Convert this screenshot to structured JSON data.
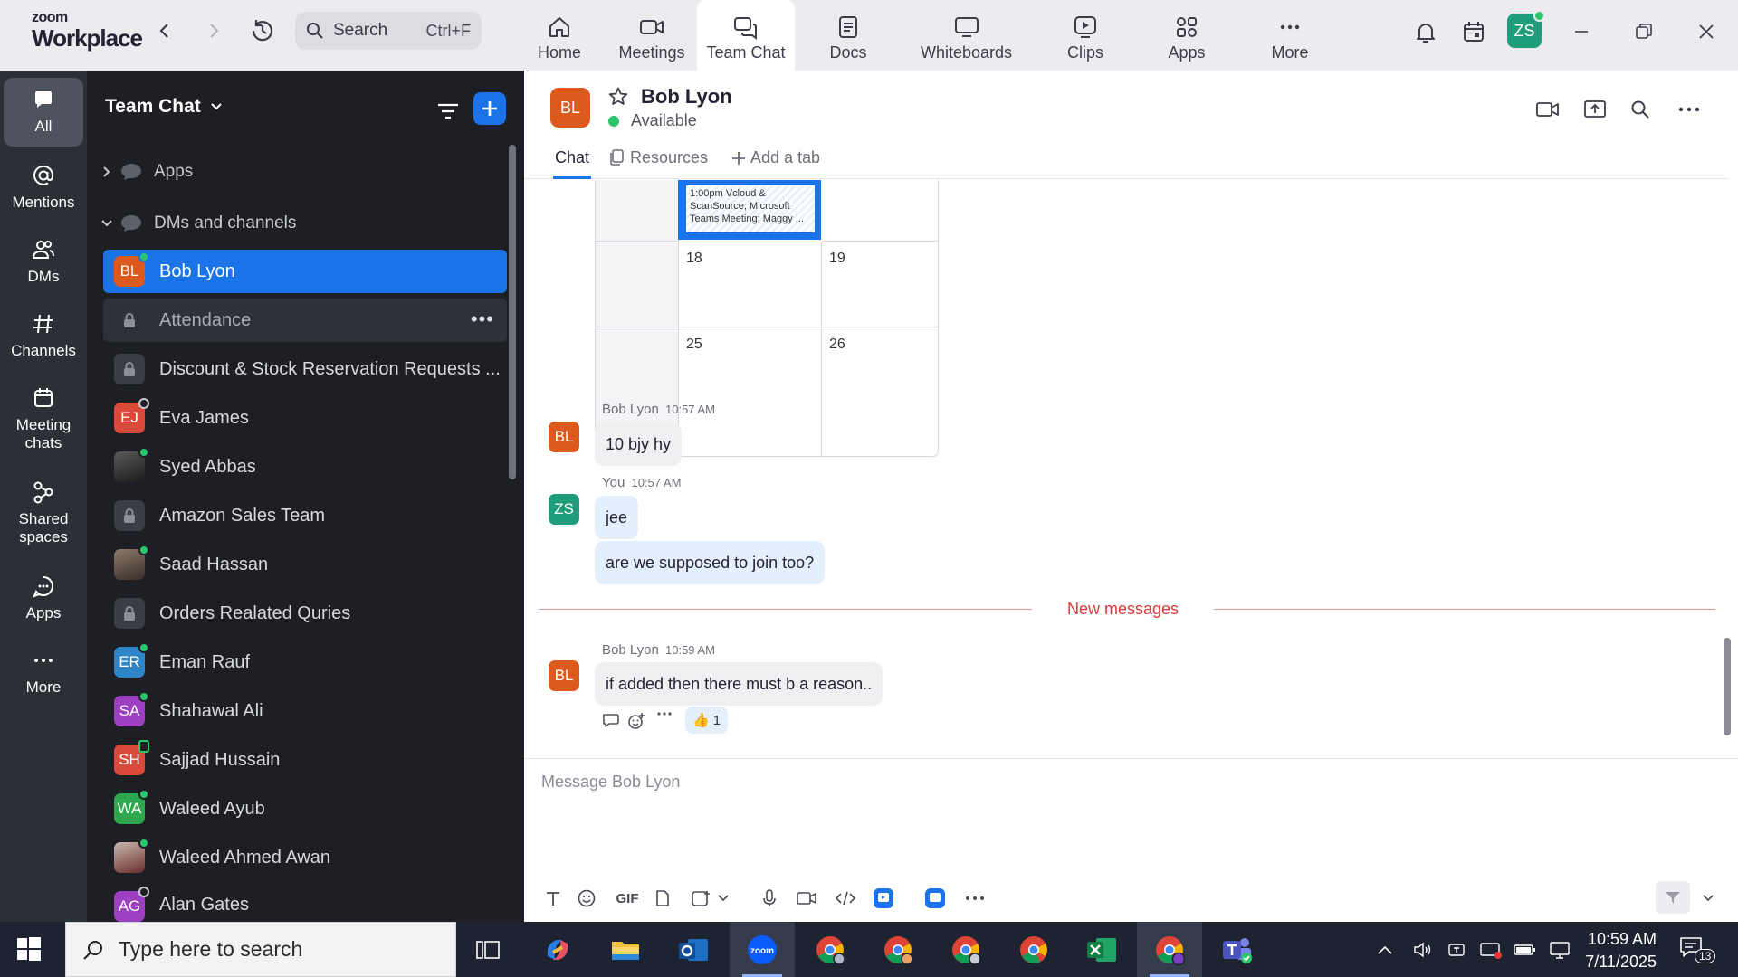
{
  "brand": {
    "line1": "zoom",
    "line2": "Workplace"
  },
  "search": {
    "label": "Search",
    "shortcut": "Ctrl+F"
  },
  "top_tabs": [
    {
      "label": "Home",
      "icon": "home-icon"
    },
    {
      "label": "Meetings",
      "icon": "video-camera-icon"
    },
    {
      "label": "Team Chat",
      "icon": "chat-bubbles-icon",
      "active": true
    },
    {
      "label": "Docs",
      "icon": "document-icon"
    },
    {
      "label": "Whiteboards",
      "icon": "whiteboard-icon"
    },
    {
      "label": "Clips",
      "icon": "clips-icon"
    },
    {
      "label": "Apps",
      "icon": "apps-grid-icon"
    },
    {
      "label": "More",
      "icon": "more-dots-icon"
    }
  ],
  "user": {
    "initials": "ZS"
  },
  "rail": [
    {
      "label": "All",
      "icon": "chat-icon",
      "active": true
    },
    {
      "label": "Mentions",
      "icon": "at-icon"
    },
    {
      "label": "DMs",
      "icon": "people-icon"
    },
    {
      "label": "Channels",
      "icon": "hash-icon"
    },
    {
      "label": "Meeting\nchats",
      "label1": "Meeting",
      "label2": "chats",
      "icon": "calendar-icon"
    },
    {
      "label1": "Shared",
      "label2": "spaces",
      "icon": "shared-spaces-icon"
    },
    {
      "label": "Apps",
      "icon": "apps-bubble-icon"
    },
    {
      "label": "More",
      "icon": "more-dots-icon"
    }
  ],
  "channel_list": {
    "title": "Team Chat",
    "sections": {
      "apps": "Apps",
      "dms": "DMs and channels"
    },
    "rows": [
      {
        "name": "Bob Lyon",
        "initials": "BL",
        "color": "#dd5a1f",
        "status": "online",
        "selected": true
      },
      {
        "name": "Attendance",
        "type": "private-channel",
        "hover": true
      },
      {
        "name": "Discount & Stock Reservation Requests ...",
        "type": "private-channel"
      },
      {
        "name": "Eva James",
        "initials": "EJ",
        "color": "#d94a3a",
        "status": "away"
      },
      {
        "name": "Syed Abbas",
        "initials": "",
        "color": "#3a3a3a",
        "status": "online",
        "photo": true
      },
      {
        "name": "Amazon Sales Team",
        "type": "private-channel"
      },
      {
        "name": "Saad Hassan",
        "initials": "",
        "color": "#5a4a40",
        "status": "online",
        "photo": true
      },
      {
        "name": "Orders Realated Quries",
        "type": "private-channel"
      },
      {
        "name": "Eman Rauf",
        "initials": "ER",
        "color": "#2e86c8",
        "status": "online"
      },
      {
        "name": "Shahawal Ali",
        "initials": "SA",
        "color": "#9c3fc0",
        "status": "online"
      },
      {
        "name": "Sajjad Hussain",
        "initials": "SH",
        "color": "#d94a3a",
        "status": "mobile"
      },
      {
        "name": "Waleed Ayub",
        "initials": "WA",
        "color": "#2ea84e",
        "status": "online"
      },
      {
        "name": "Waleed Ahmed Awan",
        "initials": "",
        "color": "#7a3c3c",
        "status": "online",
        "photo": true
      },
      {
        "name": "Alan Gates",
        "initials": "AG",
        "color": "#9c3fc0",
        "status": "offline"
      }
    ]
  },
  "chat": {
    "name": "Bob Lyon",
    "initials": "BL",
    "status": "Available",
    "tabs": {
      "chat": "Chat",
      "resources": "Resources",
      "add": "Add a tab"
    },
    "calendar": {
      "event": "1:00pm Vcloud & ScanSource; Microsoft Teams Meeting; Maggy ...",
      "days": [
        "18",
        "19",
        "25",
        "26"
      ]
    },
    "messages": [
      {
        "sender": "Bob Lyon",
        "time": "10:57 AM",
        "initials": "BL",
        "texts": [
          "10 bjy hy"
        ]
      },
      {
        "sender": "You",
        "time": "10:57 AM",
        "initials": "ZS",
        "texts": [
          "jee",
          "are we supposed to join too?"
        ]
      },
      {
        "sender": "Bob Lyon",
        "time": "10:59 AM",
        "initials": "BL",
        "texts": [
          "if added then there must b a reason.."
        ]
      }
    ],
    "new_messages_label": "New messages",
    "reaction": {
      "emoji": "👍",
      "count": "1"
    },
    "composer_placeholder": "Message Bob Lyon",
    "composer_gif": "GIF"
  },
  "taskbar": {
    "search_placeholder": "Type here to search",
    "time": "10:59 AM",
    "date": "7/11/2025",
    "notifications": "13"
  }
}
